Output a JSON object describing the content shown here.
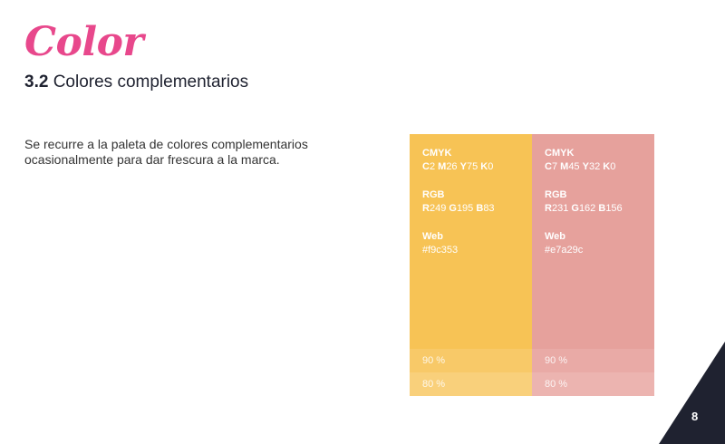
{
  "header": {
    "title": "Color",
    "section_number": "3.2",
    "section_title": "Colores complementarios"
  },
  "description": {
    "line1": "Se recurre a la paleta de colores complementarios",
    "line2": "ocasionalmente para dar frescura a la marca."
  },
  "colors": {
    "brand_pink": "#e8488c",
    "navy": "#1f2230"
  },
  "swatches": [
    {
      "color": "#f7c355",
      "tint90": "#f8c968",
      "tint80": "#f9d07b",
      "cmyk_label": "CMYK",
      "cmyk": {
        "C": "2",
        "M": "26",
        "Y": "75",
        "K": "0"
      },
      "rgb_label": "RGB",
      "rgb": {
        "R": "249",
        "G": "195",
        "B": "83"
      },
      "web_label": "Web",
      "web": "#f9c353",
      "tint90_label": "90 %",
      "tint80_label": "80 %"
    },
    {
      "color": "#e6a19c",
      "tint90": "#e9aaa6",
      "tint80": "#ecb4b0",
      "cmyk_label": "CMYK",
      "cmyk": {
        "C": "7",
        "M": "45",
        "Y": "32",
        "K": "0"
      },
      "rgb_label": "RGB",
      "rgb": {
        "R": "231",
        "G": "162",
        "B": "156"
      },
      "web_label": "Web",
      "web": "#e7a29c",
      "tint90_label": "90 %",
      "tint80_label": "80 %"
    }
  ],
  "footer": {
    "page_number": "8"
  }
}
